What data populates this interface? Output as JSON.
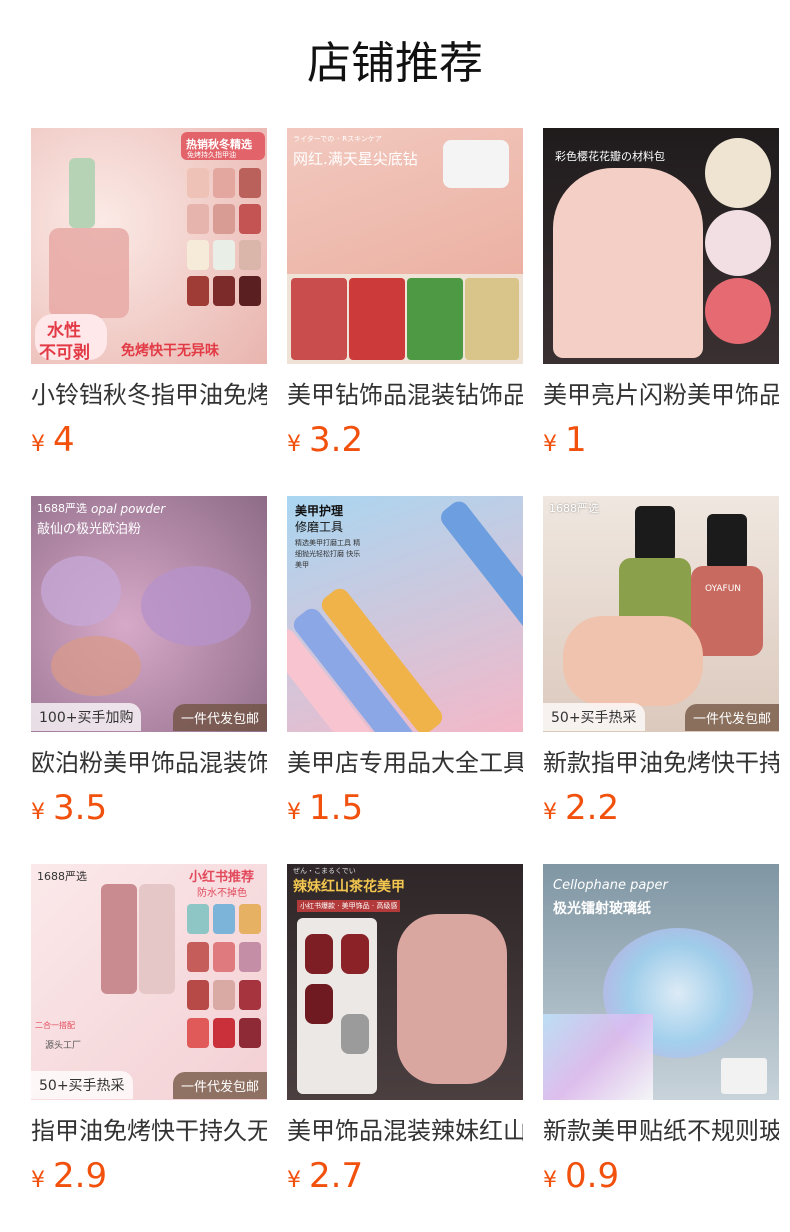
{
  "page": {
    "title": "店铺推荐"
  },
  "products": [
    {
      "name": "小铃铛秋冬指甲油免烤",
      "currency": "¥",
      "price": "4",
      "image": {
        "banner": "热销秋冬精选",
        "sub": "免烤持久指甲油",
        "stamp1": "水性",
        "stamp2": "不可剥",
        "stamp3": "免烤快干无异味"
      }
    },
    {
      "name": "美甲钻饰品混装钻饰品",
      "currency": "¥",
      "price": "3.2",
      "image": {
        "topline": "ライターでの ･ Rスキンケア",
        "banner": "网红.满天星尖底钻"
      }
    },
    {
      "name": "美甲亮片闪粉美甲饰品",
      "currency": "¥",
      "price": "1",
      "image": {
        "banner": "彩色樱花花瓣の材料包"
      }
    },
    {
      "name": "欧泊粉美甲饰品混装饰",
      "currency": "¥",
      "price": "3.5",
      "image": {
        "badge": "1688严选",
        "script": "opal powder",
        "banner": "敲仙の极光欧泊粉",
        "left_tag": "100+买手加购",
        "right_tag": "一件代发包邮"
      }
    },
    {
      "name": "美甲店专用品大全工具",
      "currency": "¥",
      "price": "1.5",
      "image": {
        "banner1": "美甲护理",
        "banner2": "修磨工具",
        "desc": "精选美甲打磨工具 精细抛光轻松打磨 快乐美甲"
      }
    },
    {
      "name": "新款指甲油免烤快干持",
      "currency": "¥",
      "price": "2.2",
      "image": {
        "badge": "1688严选",
        "brand": "OYAFUN",
        "left_tag": "50+买手热采",
        "right_tag": "一件代发包邮"
      }
    },
    {
      "name": "指甲油免烤快干持久无",
      "currency": "¥",
      "price": "2.9",
      "image": {
        "badge": "1688严选",
        "banner": "小红书推荐",
        "sub": "防水不掉色",
        "note": "二合一搭配",
        "brand": "源头工厂",
        "left_tag": "50+买手热采",
        "right_tag": "一件代发包邮"
      }
    },
    {
      "name": "美甲饰品混装辣妹红山",
      "currency": "¥",
      "price": "2.7",
      "image": {
        "topline": "ぜん・こまるくでい",
        "banner": "辣妹红山茶花美甲",
        "sub": "小红书爆款 · 美甲饰品 · 高级感"
      }
    },
    {
      "name": "新款美甲贴纸不规则玻",
      "currency": "¥",
      "price": "0.9",
      "image": {
        "script": "Cellophane paper",
        "banner": "极光镭射玻璃纸"
      }
    }
  ],
  "colors": {
    "price": "#f1500d",
    "title": "#111111",
    "name": "#333333"
  }
}
